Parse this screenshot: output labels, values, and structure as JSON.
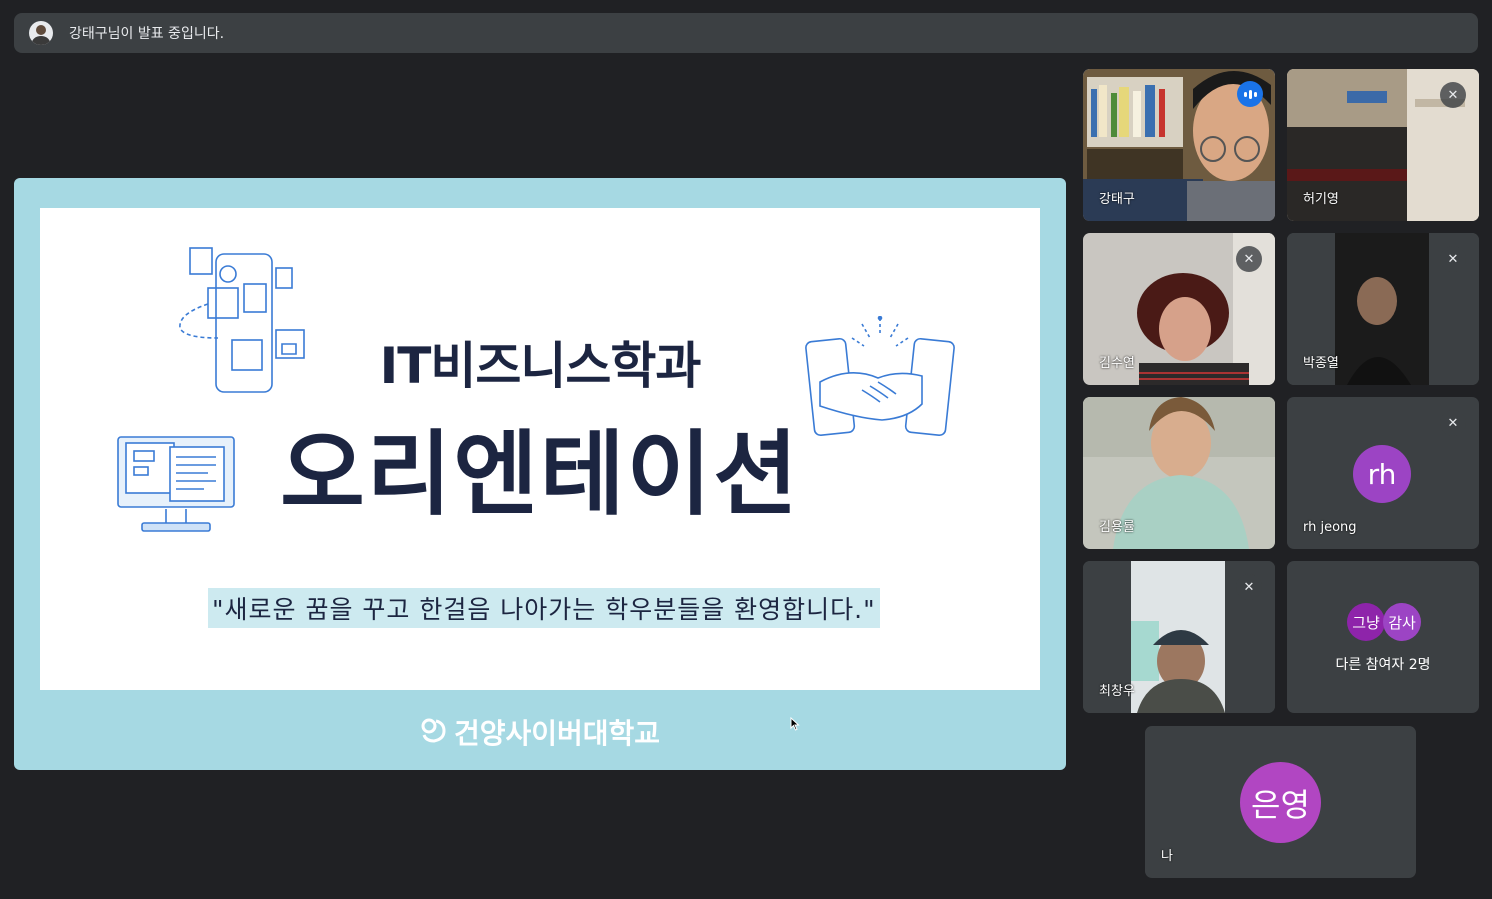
{
  "banner": {
    "text": "강태구님이 발표 중입니다."
  },
  "slide": {
    "title_small": "IT비즈니스학과",
    "title_big": "오리엔테이션",
    "subtitle": "\"새로운 꿈을 꾸고 한걸음 나아가는 학우분들을 환영합니다.\"",
    "logo": "건양사이버대학교"
  },
  "participants": [
    {
      "name": "강태구",
      "state": "speaking"
    },
    {
      "name": "허기영",
      "state": "muted"
    },
    {
      "name": "김수연",
      "state": "muted"
    },
    {
      "name": "박종열",
      "state": "muted"
    },
    {
      "name": "김용률",
      "state": "unmuted"
    },
    {
      "name": "rh jeong",
      "state": "muted",
      "initials": "rh",
      "avatar_color": "#9c44c4"
    },
    {
      "name": "최창우",
      "state": "muted"
    }
  ],
  "others": {
    "label": "다른 참여자 2명",
    "avatars": [
      {
        "initials": "그냥",
        "color": "#8e24aa"
      },
      {
        "initials": "감사",
        "color": "#9c44c4"
      }
    ]
  },
  "self": {
    "name": "나",
    "initials": "은영",
    "avatar_color": "#b146c2"
  },
  "icons": {
    "muted": "mic-off-icon",
    "speaking": "audio-level-icon"
  },
  "colors": {
    "accent": "#1a73e8",
    "tile_bg": "#3c4043",
    "page_bg": "#202124",
    "slide_frame": "#a6d9e3",
    "slide_text": "#1c2541"
  }
}
